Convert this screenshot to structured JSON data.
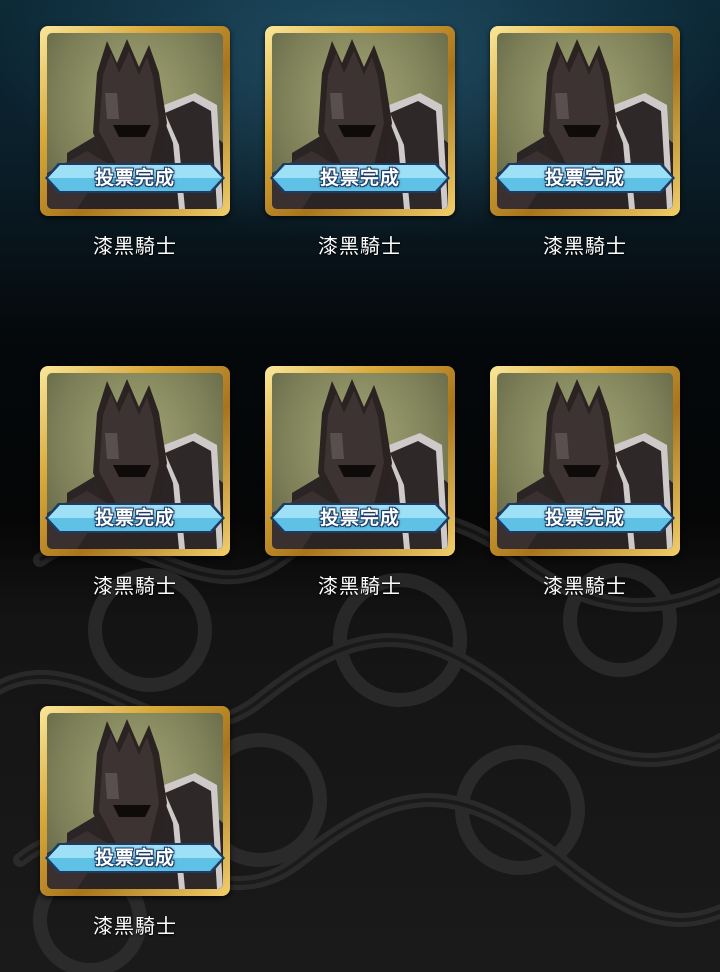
{
  "colors": {
    "frame_gold": "#d9a93a",
    "badge_blue": "#5fc1e6",
    "badge_outline": "#1c3c66",
    "portrait_bg": "#8a8c62",
    "armor_dark": "#2a2424"
  },
  "cards": [
    {
      "hero_name": "漆黑騎士",
      "badge_label": "投票完成",
      "icon": "black-knight-portrait"
    },
    {
      "hero_name": "漆黑騎士",
      "badge_label": "投票完成",
      "icon": "black-knight-portrait"
    },
    {
      "hero_name": "漆黑騎士",
      "badge_label": "投票完成",
      "icon": "black-knight-portrait"
    },
    {
      "hero_name": "漆黑騎士",
      "badge_label": "投票完成",
      "icon": "black-knight-portrait"
    },
    {
      "hero_name": "漆黑騎士",
      "badge_label": "投票完成",
      "icon": "black-knight-portrait"
    },
    {
      "hero_name": "漆黑騎士",
      "badge_label": "投票完成",
      "icon": "black-knight-portrait"
    },
    {
      "hero_name": "漆黑騎士",
      "badge_label": "投票完成",
      "icon": "black-knight-portrait"
    }
  ]
}
